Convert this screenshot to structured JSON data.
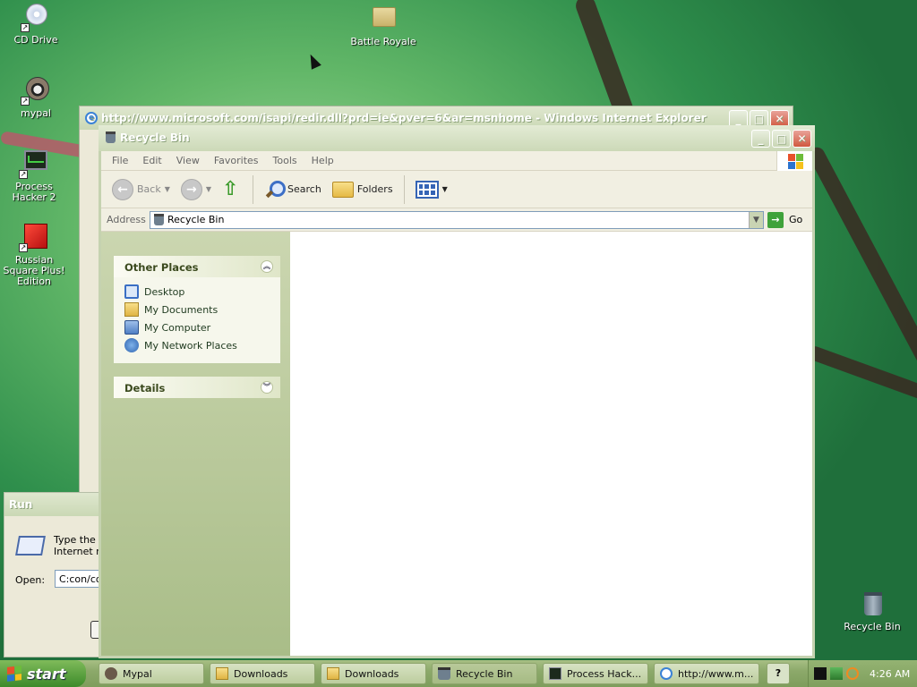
{
  "desktop_icons": [
    {
      "label": "CD Drive"
    },
    {
      "label": "Battle Royale"
    },
    {
      "label": "mypal"
    },
    {
      "label": "Process Hacker 2"
    },
    {
      "label": "Russian Square Plus! Edition"
    },
    {
      "label": "Recycle Bin"
    }
  ],
  "ie_window": {
    "title": "http://www.microsoft.com/isapi/redir.dll?prd=ie&pver=6&ar=msnhome - Windows Internet Explorer"
  },
  "run_dialog": {
    "title": "Run",
    "desc_line1": "Type the n",
    "desc_line2": "Internet re",
    "open_label": "Open:",
    "open_value": "C:con/con"
  },
  "recycle_bin": {
    "title": "Recycle Bin",
    "menu": [
      "File",
      "Edit",
      "View",
      "Favorites",
      "Tools",
      "Help"
    ],
    "toolbar": {
      "back": "Back",
      "search": "Search",
      "folders": "Folders"
    },
    "address": {
      "label": "Address",
      "value": "Recycle Bin",
      "go": "Go"
    },
    "other_places": {
      "header": "Other Places",
      "items": [
        "Desktop",
        "My Documents",
        "My Computer",
        "My Network Places"
      ]
    },
    "details": {
      "header": "Details"
    }
  },
  "taskbar": {
    "start": "start",
    "buttons": [
      "Mypal",
      "Downloads",
      "Downloads",
      "Recycle Bin",
      "Process Hack...",
      "http://www.m..."
    ],
    "clock": "4:26 AM"
  }
}
